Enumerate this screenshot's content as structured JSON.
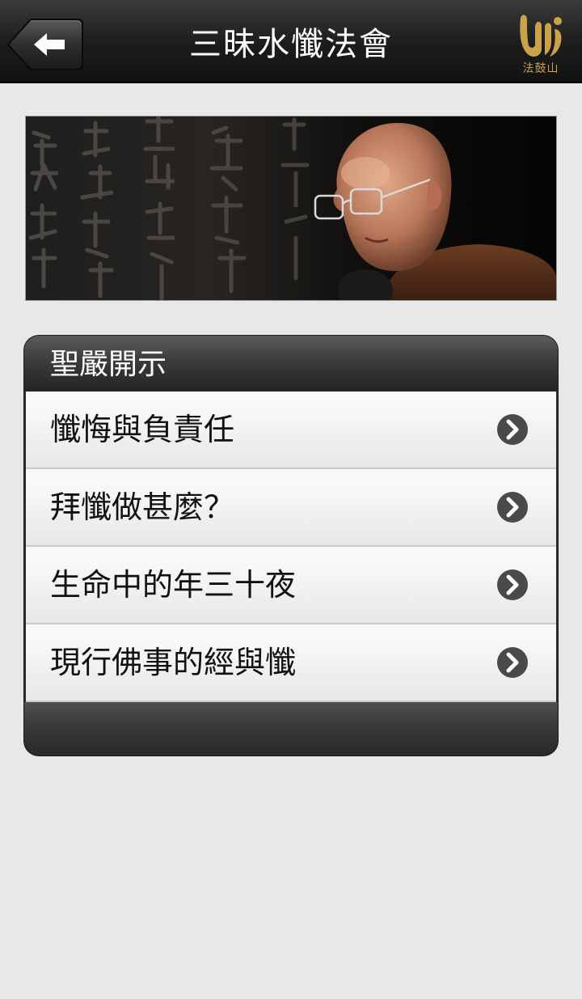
{
  "header": {
    "title": "三昧水懺法會",
    "back_icon": "arrow-left-icon",
    "logo_text": "法鼓山"
  },
  "banner": {
    "image": "calligraphy-and-monk-photo"
  },
  "section": {
    "title": "聖嚴開示",
    "items": [
      {
        "label": "懺悔與負責任",
        "icon": "chevron-right-icon"
      },
      {
        "label": "拜懺做甚麼？",
        "icon": "chevron-right-icon"
      },
      {
        "label": "生命中的年三十夜",
        "icon": "chevron-right-icon"
      },
      {
        "label": "現行佛事的經與懺",
        "icon": "chevron-right-icon"
      }
    ]
  },
  "colors": {
    "header_bg": "#1c1c1c",
    "page_bg": "#e8e8e8",
    "logo_gold": "#c9a24a",
    "chevron": "#4a4a4a"
  }
}
